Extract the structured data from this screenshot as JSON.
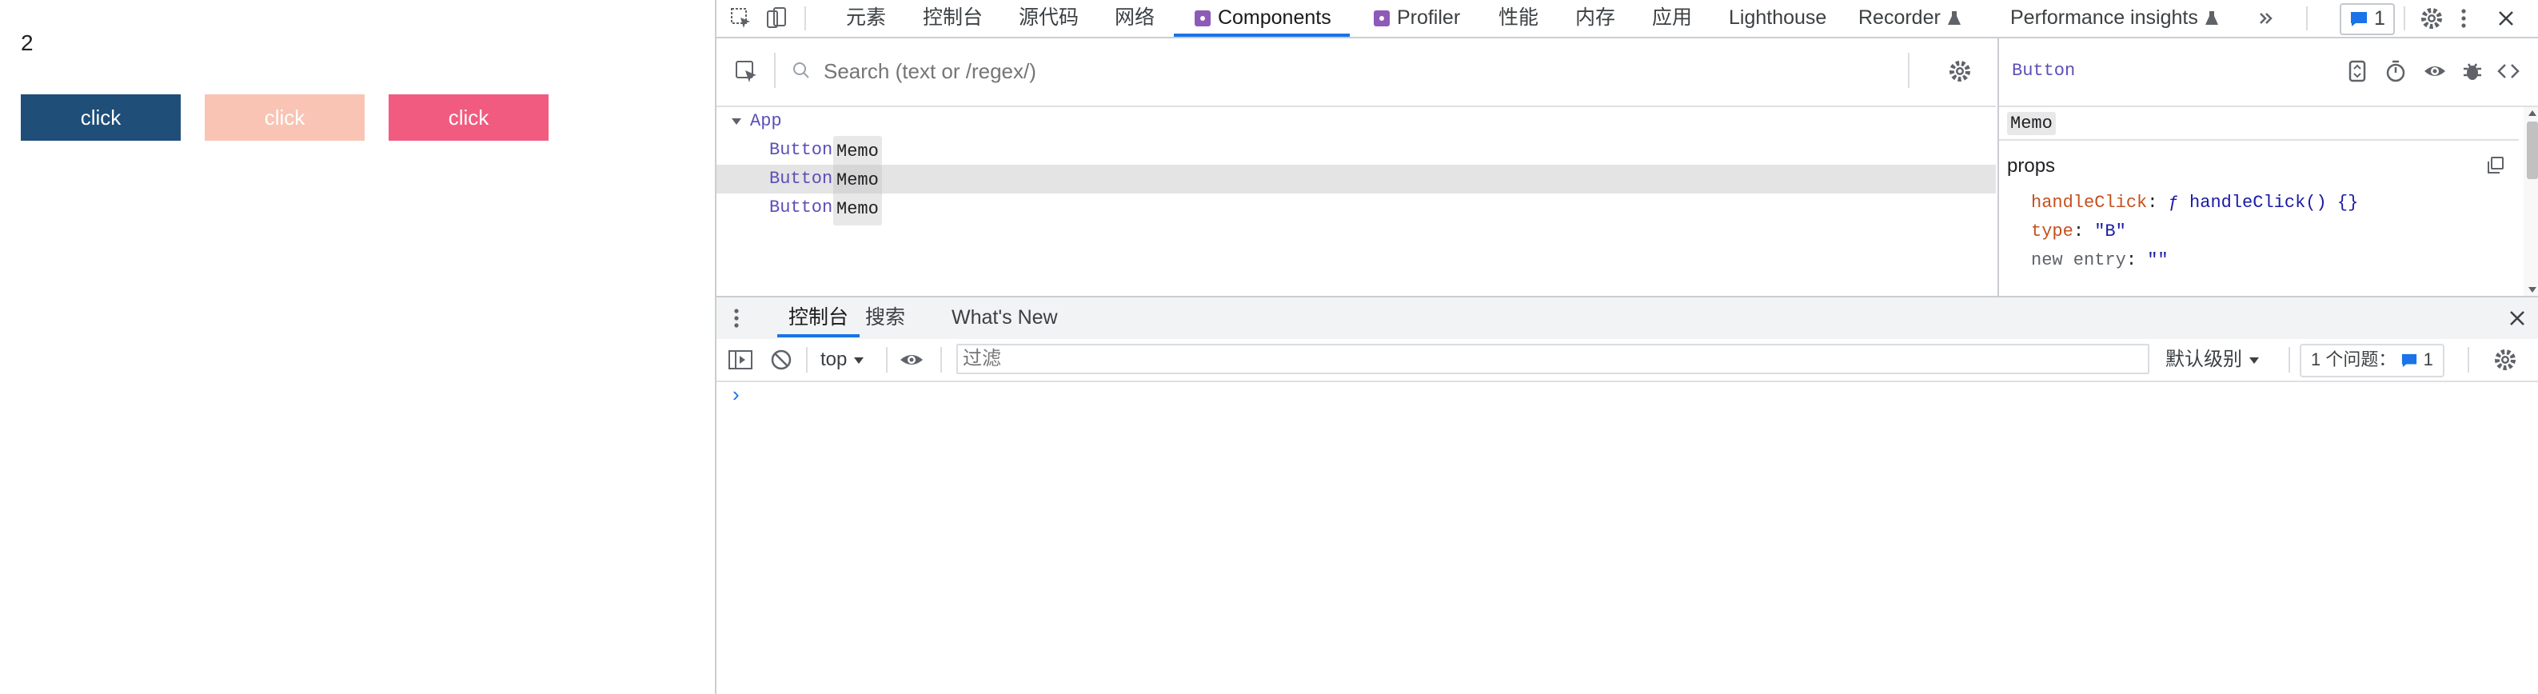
{
  "page": {
    "counter": "2",
    "buttons": [
      {
        "label": "click",
        "color": "#1f4e79"
      },
      {
        "label": "click",
        "color": "#f9c4b4"
      },
      {
        "label": "click",
        "color": "#f25b80"
      }
    ]
  },
  "devtools": {
    "tabs": [
      "元素",
      "控制台",
      "源代码",
      "网络",
      "Components",
      "Profiler",
      "性能",
      "内存",
      "应用",
      "Lighthouse",
      "Recorder",
      "Performance insights"
    ],
    "issues_badge": "1",
    "search_placeholder": "Search (text or /regex/)",
    "tree": {
      "root": "App",
      "rows": [
        {
          "component": "Button",
          "badge": "Memo"
        },
        {
          "component": "Button",
          "badge": "Memo"
        },
        {
          "component": "Button",
          "badge": "Memo"
        }
      ]
    },
    "detail": {
      "title": "Button",
      "badge": "Memo",
      "section": "props",
      "props": [
        {
          "key": "handleClick",
          "value": "ƒ handleClick() {}"
        },
        {
          "key": "type",
          "value": "\"B\""
        },
        {
          "key": "new entry",
          "value": "\"\""
        }
      ]
    },
    "drawer_tabs": [
      "控制台",
      "搜索",
      "What's New"
    ],
    "console": {
      "context": "top",
      "filter_placeholder": "过滤",
      "level": "默认级别",
      "issues_label": "1 个问题：",
      "issues_count": "1",
      "prompt": "›"
    },
    "accent": "#1a73e8"
  }
}
